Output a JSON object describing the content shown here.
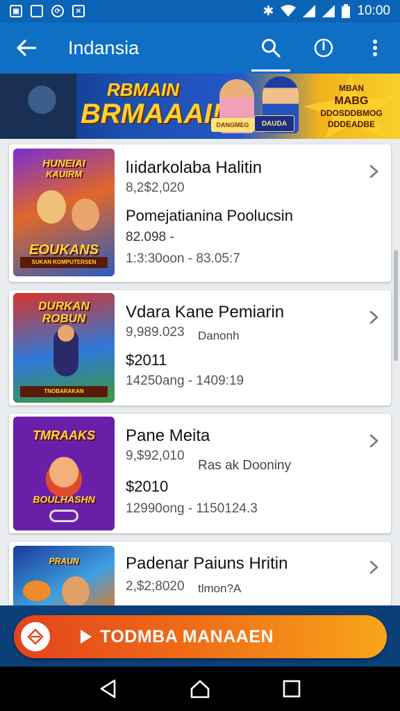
{
  "status_bar": {
    "time": "10:00"
  },
  "app_bar": {
    "title": "Indansia"
  },
  "banner": {
    "headline_line1": "RBMAIN",
    "headline_line2": "BRMAAAI!",
    "logo_left": "DANGMEG",
    "logo_right": "DAUDA",
    "side_line1": "MBAN",
    "side_line2": "MABG",
    "side_line3": "DDOSDDBMOG",
    "side_line4": "DDDEADBE"
  },
  "cards": [
    {
      "thumb_title_line1": "HUNEIAI",
      "thumb_title_line2": "KAUIRM",
      "thumb_title_line3": "EOUKANS",
      "thumb_footer": "SUKAN KOMPUTERSEN",
      "title": "lıidarkolaba Halitin",
      "sub": "8,2$2,020",
      "line3": "Pomejatianina Poolucsin",
      "line4": "82.098 -",
      "line5": "1:3:30oon -  83.05:7",
      "tag": ""
    },
    {
      "thumb_title_line1": "DURKAN",
      "thumb_title_line2": "ROBUN",
      "thumb_title_line3": "",
      "thumb_footer": "TNOBARAKAN",
      "title": "Vdara Kane Pemiarin",
      "sub": "9,989.023",
      "line3": "",
      "line4": "$2011",
      "line5": "14250ang - 1409:19",
      "tag": "Danonh"
    },
    {
      "thumb_title_line1": "TMRAAKS",
      "thumb_title_line2": "",
      "thumb_title_line3": "BOULHASHN",
      "thumb_footer": "",
      "title": "Pane Meita",
      "sub": "9,$92,010",
      "line3": "",
      "line4": "$2010",
      "line5": "12990ong - 1150124.3",
      "tag": "Ras ak Dooniny"
    },
    {
      "thumb_title_line1": "PRAUN",
      "thumb_title_line2": "",
      "thumb_title_line3": "",
      "thumb_footer": "",
      "title": "Padenar Paiuns Hritin",
      "sub": "2,$2;8020",
      "line3": "",
      "line4": "",
      "line5": "",
      "tag": "tlmon?A"
    }
  ],
  "cta": {
    "label": "TODMBA MANAAEN"
  },
  "colors": {
    "primary": "#0e6fc4",
    "cta_start": "#e2441c",
    "cta_end": "#f7a51a"
  }
}
